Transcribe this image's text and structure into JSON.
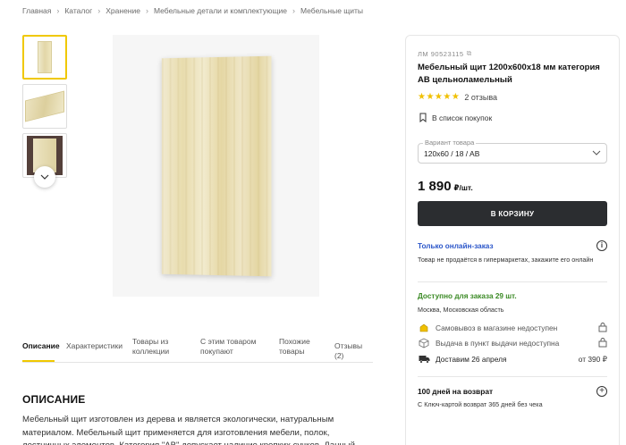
{
  "breadcrumb": [
    "Главная",
    "Каталог",
    "Хранение",
    "Мебельные детали и комплектующие",
    "Мебельные щиты"
  ],
  "product": {
    "sku": "ЛМ 90523115",
    "title": "Мебельный щит 1200x600x18 мм категория АВ цельноламельный",
    "rating_stars": "★★★★★",
    "reviews": "2 отзыва",
    "shopping_list": "В список покупок",
    "variant_label": "Вариант товара",
    "variant_value": "120x60 / 18 / AB",
    "price": "1 890",
    "price_unit": "₽/шт.",
    "cart_button": "В КОРЗИНУ"
  },
  "online_only": {
    "title": "Только онлайн-заказ",
    "note": "Товар не продаётся в гипермаркетах, закажите его онлайн"
  },
  "availability": {
    "title": "Доступно для заказа 29 шт.",
    "region": "Москва, Московская область",
    "rows": [
      {
        "icon": "store-pickup-icon",
        "text": "Самовывоз в магазине недоступен",
        "right": "lock-icon"
      },
      {
        "icon": "box-icon",
        "text": "Выдача в пункт выдачи недоступна",
        "right": "lock-icon"
      },
      {
        "icon": "truck-icon",
        "text": "Доставим 26 апреля",
        "right": "от 390 ₽"
      }
    ]
  },
  "returns": {
    "title": "100 дней на возврат",
    "note": "С Ключ-картой возврат 365 дней без чека"
  },
  "tabs": [
    "Описание",
    "Характеристики",
    "Товары из коллекции",
    "С этим товаром покупают",
    "Похожие товары",
    "Отзывы (2)"
  ],
  "description": {
    "heading": "ОПИСАНИЕ",
    "text": "Мебельный щит изготовлен из дерева и является экологически, натуральным материалом. Мебельный щит применяется для изготовления мебели, полок, лестничных элементов. Категория \"АВ\" допускает наличие крепких сучков. Данный мебельный щит"
  },
  "colors": {
    "accent": "#f0c800",
    "cart_button": "#2b2d30",
    "online_link": "#2a55c9",
    "available": "#3b8a25"
  }
}
